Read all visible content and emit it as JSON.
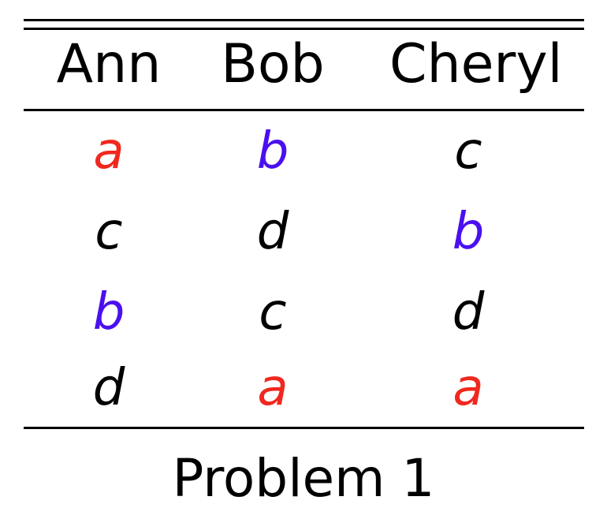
{
  "table": {
    "headers": [
      "Ann",
      "Bob",
      "Cheryl"
    ],
    "rows": [
      [
        "a",
        "b",
        "c"
      ],
      [
        "c",
        "d",
        "b"
      ],
      [
        "b",
        "c",
        "d"
      ],
      [
        "d",
        "a",
        "a"
      ]
    ],
    "colors": {
      "a": "#f0281e",
      "b": "#4a10f0",
      "default": "#000000"
    }
  },
  "caption": "Problem 1"
}
